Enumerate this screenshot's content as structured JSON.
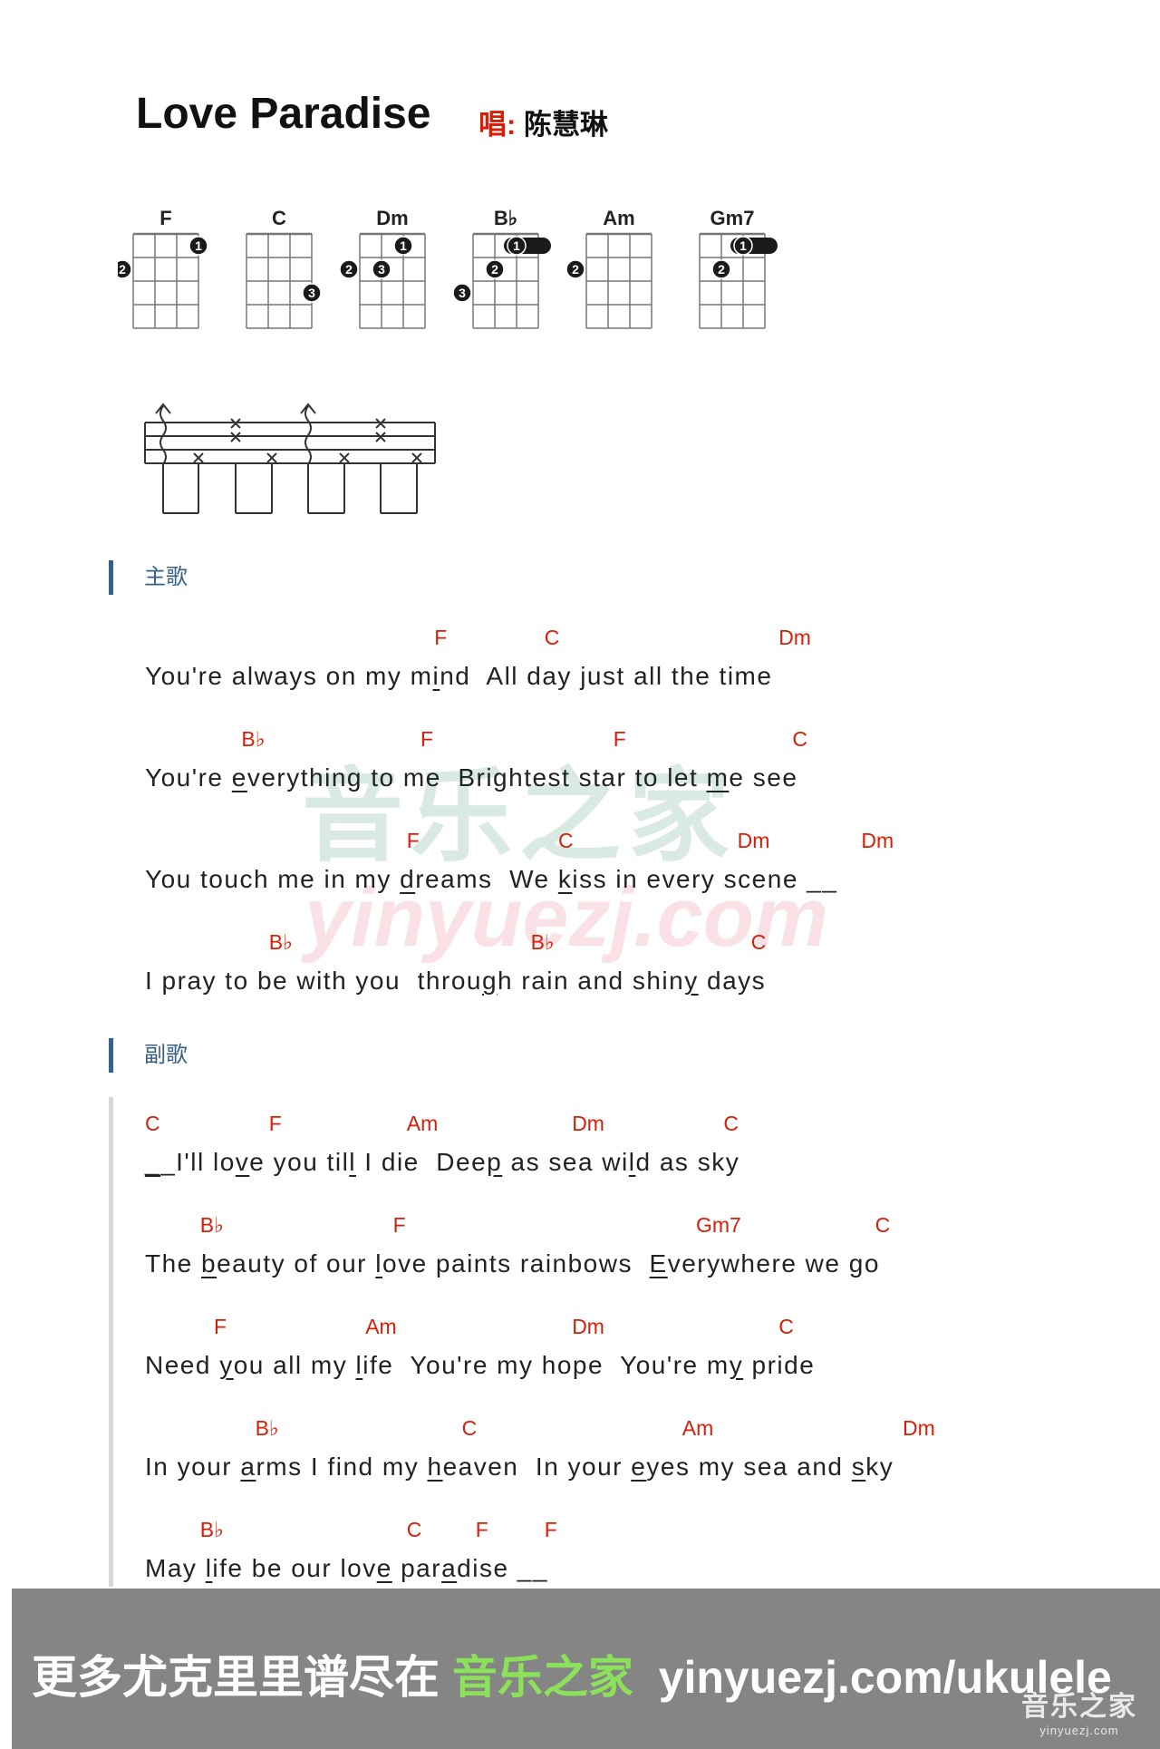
{
  "title": "Love Paradise",
  "singer_label": "唱:",
  "singer": "陈慧琳",
  "chord_diagrams": [
    {
      "name": "F",
      "dots": [
        {
          "fret": 1,
          "string": 3,
          "finger": "1"
        },
        {
          "fret": 2,
          "string": 0,
          "finger": "2"
        }
      ]
    },
    {
      "name": "C",
      "dots": [
        {
          "fret": 3,
          "string": 3,
          "finger": "3"
        }
      ]
    },
    {
      "name": "Dm",
      "dots": [
        {
          "fret": 1,
          "string": 2,
          "finger": "1"
        },
        {
          "fret": 2,
          "string": 0,
          "finger": "2"
        },
        {
          "fret": 2,
          "string": 1,
          "finger": "3"
        }
      ]
    },
    {
      "name": "B♭",
      "dots": [
        {
          "fret": 1,
          "string": 2,
          "finger": "1",
          "barre": true
        },
        {
          "fret": 2,
          "string": 1,
          "finger": "2"
        },
        {
          "fret": 3,
          "string": 0,
          "finger": "3"
        }
      ]
    },
    {
      "name": "Am",
      "dots": [
        {
          "fret": 2,
          "string": 0,
          "finger": "2"
        }
      ]
    },
    {
      "name": "Gm7",
      "dots": [
        {
          "fret": 1,
          "string": 2,
          "finger": "1",
          "barre": true
        },
        {
          "fret": 2,
          "string": 1,
          "finger": "2"
        }
      ]
    }
  ],
  "sections": [
    {
      "label": "主歌"
    },
    {
      "label": "副歌"
    }
  ],
  "verse": [
    {
      "text": "You're always on my mind  All day just all the time",
      "chords": [
        {
          "c": "F",
          "at": 21
        },
        {
          "c": "C",
          "at": 29
        },
        {
          "c": "Dm",
          "at": 46
        }
      ]
    },
    {
      "text": "You're everything to me  Brightest star to let me see",
      "chords": [
        {
          "c": "B♭",
          "at": 7
        },
        {
          "c": "F",
          "at": 20
        },
        {
          "c": "F",
          "at": 34
        },
        {
          "c": "C",
          "at": 47
        }
      ]
    },
    {
      "text": "You touch me in my dreams  We kiss in every scene __",
      "chords": [
        {
          "c": "F",
          "at": 19
        },
        {
          "c": "C",
          "at": 30
        },
        {
          "c": "Dm",
          "at": 43
        },
        {
          "c": "Dm",
          "at": 52
        }
      ]
    },
    {
      "text": "I pray to be with you  through rain and shiny days",
      "chords": [
        {
          "c": "B♭",
          "at": 9
        },
        {
          "c": "B♭",
          "at": 28
        },
        {
          "c": "C",
          "at": 44
        }
      ]
    }
  ],
  "chorus": [
    {
      "text": "__I'll love you till I die  Deep as sea wild as sky",
      "chords": [
        {
          "c": "C",
          "at": 0
        },
        {
          "c": "F",
          "at": 9
        },
        {
          "c": "Am",
          "at": 19
        },
        {
          "c": "Dm",
          "at": 31
        },
        {
          "c": "C",
          "at": 42
        }
      ]
    },
    {
      "text": "The beauty of our love paints rainbows  Everywhere we go",
      "chords": [
        {
          "c": "B♭",
          "at": 4
        },
        {
          "c": "F",
          "at": 18
        },
        {
          "c": "Gm7",
          "at": 40
        },
        {
          "c": "C",
          "at": 53
        }
      ]
    },
    {
      "text": "Need you all my life  You're my hope  You're my pride",
      "chords": [
        {
          "c": "F",
          "at": 5
        },
        {
          "c": "Am",
          "at": 16
        },
        {
          "c": "Dm",
          "at": 31
        },
        {
          "c": "C",
          "at": 46
        }
      ]
    },
    {
      "text": "In your arms I find my heaven  In your eyes my sea and sky",
      "chords": [
        {
          "c": "B♭",
          "at": 8
        },
        {
          "c": "C",
          "at": 23
        },
        {
          "c": "Am",
          "at": 39
        },
        {
          "c": "Dm",
          "at": 55
        }
      ]
    },
    {
      "text": "May life be our love paradise __",
      "chords": [
        {
          "c": "B♭",
          "at": 4
        },
        {
          "c": "C",
          "at": 19
        },
        {
          "c": "F",
          "at": 24
        },
        {
          "c": "F",
          "at": 29
        }
      ]
    }
  ],
  "watermark": {
    "cn": "音乐之家",
    "en": "yinyuezj.com"
  },
  "footer": {
    "prefix": "更多尤克里里谱尽在 ",
    "brand": "音乐之家",
    "url": "  yinyuezj.com/ukulele",
    "logo_cn": "音乐之家",
    "logo_en": "yinyuezj.com"
  },
  "colors": {
    "chord": "#d81e06",
    "section": "#35618a",
    "footer_bg": "#858585",
    "brand_green": "#8be25a"
  }
}
